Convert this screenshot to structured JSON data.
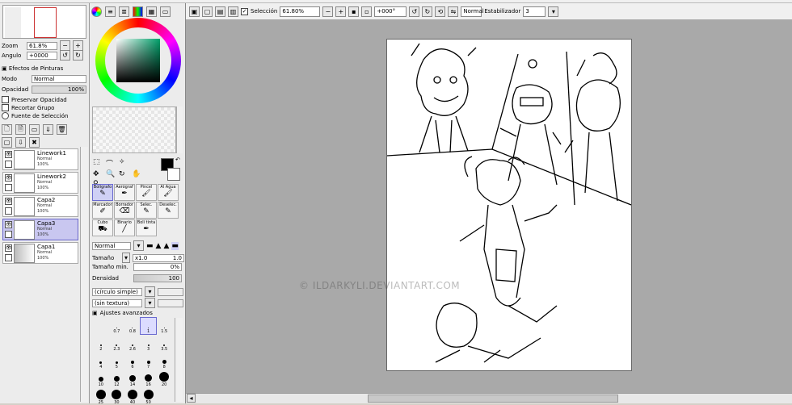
{
  "toolbar": {
    "seleccion_label": "Selección",
    "zoom_value": "61.80%",
    "angle_value": "+000°",
    "mode_value": "Normal",
    "stabilizer_label": "Estabilizador",
    "stabilizer_value": "3"
  },
  "navigator": {
    "zoom_label": "Zoom",
    "zoom_value": "61.8%",
    "angle_label": "Angulo",
    "angle_value": "+0000"
  },
  "effects": {
    "title": "Efectos de Pinturas",
    "mode_label": "Modo",
    "mode_value": "Normal",
    "opacity_label": "Opacidad",
    "opacity_value": "100%",
    "opt1": "Preservar Opacidad",
    "opt2": "Recortar Grupo",
    "opt3": "Fuente de Selección"
  },
  "layers": [
    {
      "name": "Linework1",
      "mode": "Normal",
      "opacity": "100%"
    },
    {
      "name": "Linework2",
      "mode": "Normal",
      "opacity": "100%"
    },
    {
      "name": "Capa2",
      "mode": "Normal",
      "opacity": "100%"
    },
    {
      "name": "Capa3",
      "mode": "Normal",
      "opacity": "100%"
    },
    {
      "name": "Capa1",
      "mode": "Normal",
      "opacity": "100%"
    }
  ],
  "tools": [
    {
      "label": "Bolígrafo"
    },
    {
      "label": "Aerógraf"
    },
    {
      "label": "Pincel"
    },
    {
      "label": "Al Agua"
    },
    {
      "label": "Marcador"
    },
    {
      "label": "Borrador"
    },
    {
      "label": "Selec."
    },
    {
      "label": "Deselec."
    },
    {
      "label": "Cubo"
    },
    {
      "label": "Binario"
    },
    {
      "label": "Boli tinta"
    },
    {
      "label": ""
    }
  ],
  "brush": {
    "mode_value": "Normal",
    "size_label": "Tamaño",
    "size_mult": "x1.0",
    "size_value": "1.0",
    "min_size_label": "Tamaño min.",
    "min_size_value": "0%",
    "density_label": "Densidad",
    "density_value": "100",
    "shape_value": "(círculo simple)",
    "texture_value": "(sin textura)",
    "advanced_label": "Ajustes avanzados"
  },
  "brush_sizes": [
    "0.7",
    "0.8",
    "1",
    "1.5",
    "2",
    "2.3",
    "2.6",
    "3",
    "3.5",
    "4",
    "5",
    "6",
    "7",
    "8",
    "10",
    "12",
    "14",
    "16",
    "20",
    "25",
    "30",
    "40",
    "50"
  ],
  "watermark": "© ILDARKYLI.DEVIANTART.COM",
  "colors": {
    "accent": "#6a6ad0",
    "selected_layer": "#c9c7f0",
    "canvas_bg": "#a9a9a9"
  }
}
